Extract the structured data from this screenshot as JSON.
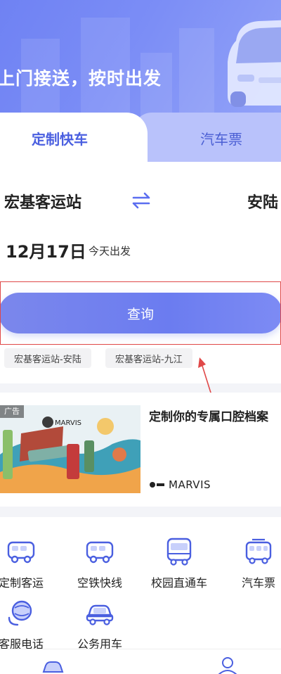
{
  "banner": {
    "slogan": "上门接送，按时出发"
  },
  "tabs": {
    "active": "定制快车",
    "inactive": "汽车票"
  },
  "trip": {
    "from": "宏基客运站",
    "to": "安陆",
    "date": "12月17日",
    "date_hint": "今天出发"
  },
  "search": {
    "label": "查询"
  },
  "history": [
    "宏基客运站-安陆",
    "宏基客运站-九江"
  ],
  "ad": {
    "tag": "广告",
    "headline": "定制你的专属口腔档案",
    "brand": "MARVIS",
    "image_brand": "MARVIS"
  },
  "services": [
    {
      "label": "定制客运",
      "icon": "van-icon"
    },
    {
      "label": "空铁快线",
      "icon": "van-icon"
    },
    {
      "label": "校园直通车",
      "icon": "bus-icon"
    },
    {
      "label": "汽车票",
      "icon": "coach-icon"
    },
    {
      "label": "客服电话",
      "icon": "phone-globe-icon"
    },
    {
      "label": "公务用车",
      "icon": "car-icon"
    }
  ],
  "colors": {
    "accent": "#5b6ef0",
    "annotation": "#e04848"
  }
}
